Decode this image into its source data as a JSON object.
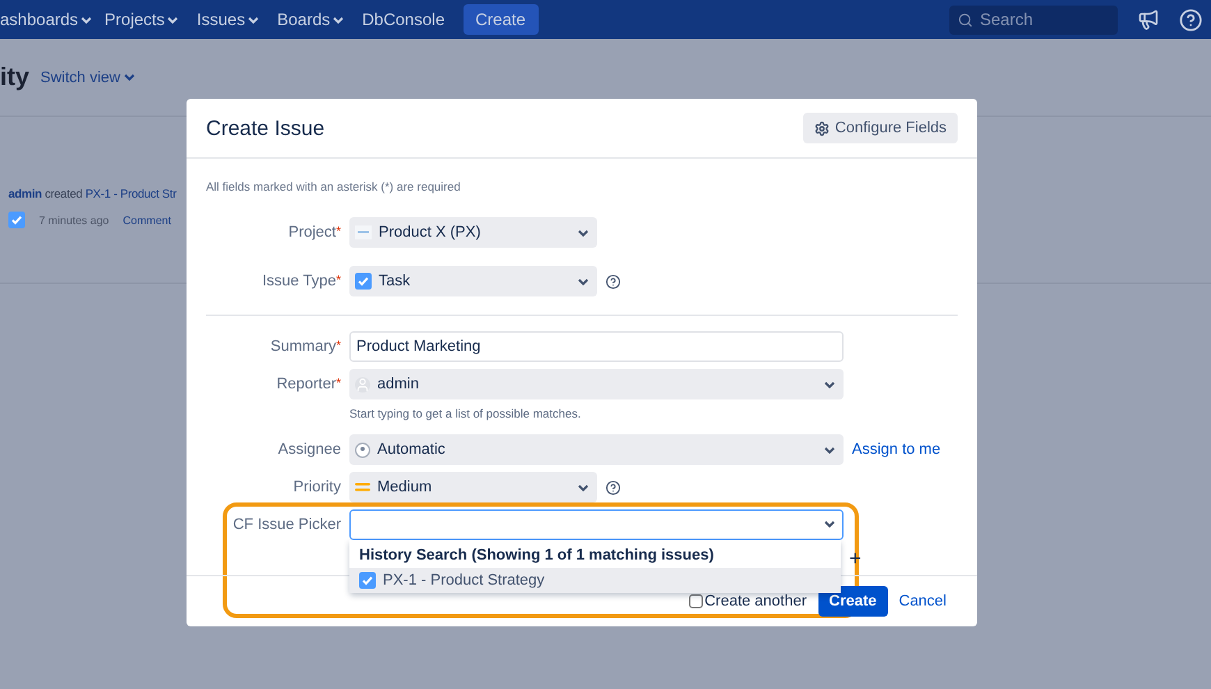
{
  "nav": {
    "items": [
      {
        "label": "ashboards",
        "has_menu": true
      },
      {
        "label": "Projects",
        "has_menu": true
      },
      {
        "label": "Issues",
        "has_menu": true
      },
      {
        "label": "Boards",
        "has_menu": true
      },
      {
        "label": "DbConsole",
        "has_menu": false
      }
    ],
    "create": "Create",
    "search": {
      "placeholder": "Search"
    }
  },
  "page": {
    "title": "ity",
    "switch_view": "Switch view",
    "activity": {
      "user": "admin",
      "action": "created",
      "issue": "PX-1 - Product Str",
      "time": "7 minutes ago",
      "comment": "Comment"
    }
  },
  "dialog": {
    "title": "Create Issue",
    "configure_button": "Configure Fields",
    "required_note": "All fields marked with an asterisk (*) are required",
    "required_mark": "*",
    "fields": [
      {
        "label": "Project",
        "required": true,
        "kind": "select",
        "value": "Product X (PX)",
        "help": false
      },
      {
        "label": "Issue Type",
        "required": true,
        "kind": "select",
        "value": "Task",
        "help": true
      },
      {
        "label": "Summary",
        "required": true,
        "kind": "text",
        "value": "Product Marketing",
        "help": false,
        "divider_before": true
      },
      {
        "label": "Reporter",
        "required": true,
        "kind": "select",
        "value": "admin",
        "help": false,
        "hint": "Start typing to get a list of possible matches."
      },
      {
        "label": "Assignee",
        "required": false,
        "kind": "select",
        "value": "Automatic",
        "help": false,
        "link": "Assign to me"
      },
      {
        "label": "Priority",
        "required": false,
        "kind": "select",
        "value": "Medium",
        "help": true
      },
      {
        "label": "CF Issue Picker",
        "required": false,
        "kind": "picker",
        "help": false,
        "focused": true
      }
    ],
    "add_symbol": "+",
    "dropdown": {
      "heading": "History Search (Showing 1 of 1 matching issues)",
      "items": [
        {
          "label": "PX-1 - Product Strategy",
          "selected": true
        }
      ]
    },
    "footer": {
      "create_another": {
        "label": "Create another",
        "checked": false
      },
      "submit": "Create",
      "cancel": "Cancel"
    }
  }
}
